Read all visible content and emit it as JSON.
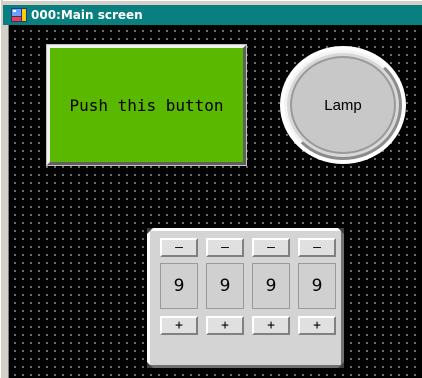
{
  "window": {
    "title": "000:Main screen",
    "title_bar_color": "#0a7f7f",
    "icon": "screen-app-icon"
  },
  "canvas": {
    "background": "#000000",
    "grid": "dotted"
  },
  "push_button": {
    "label": "Push this button",
    "color": "#5ab800"
  },
  "lamp": {
    "label": "Lamp",
    "color": "#c8c8c8"
  },
  "digit_switch": {
    "digits": [
      {
        "minus": "—",
        "value": "9",
        "plus": "+"
      },
      {
        "minus": "—",
        "value": "9",
        "plus": "+"
      },
      {
        "minus": "—",
        "value": "9",
        "plus": "+"
      },
      {
        "minus": "—",
        "value": "9",
        "plus": "+"
      }
    ]
  }
}
